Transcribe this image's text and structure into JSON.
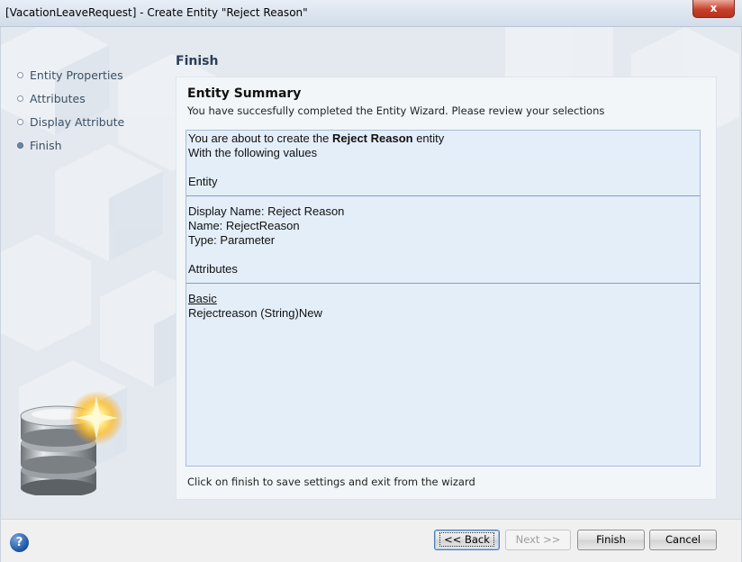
{
  "window": {
    "title": "[VacationLeaveRequest] - Create Entity \"Reject Reason\"",
    "close_label": "x"
  },
  "sidebar": {
    "steps": [
      {
        "label": "Entity Properties",
        "active": false
      },
      {
        "label": "Attributes",
        "active": false
      },
      {
        "label": "Display Attribute",
        "active": false
      },
      {
        "label": "Finish",
        "active": true
      }
    ]
  },
  "page": {
    "heading": "Finish"
  },
  "summary": {
    "title": "Entity Summary",
    "subtitle": "You have succesfully completed the Entity Wizard. Please review your selections",
    "intro_prefix": "You are about to create the ",
    "entity_name": "Reject Reason",
    "intro_suffix": " entity",
    "intro_line2": "With the following values",
    "entity_section": "Entity",
    "display_name": "Display Name: Reject Reason",
    "name": "Name: RejectReason",
    "type": "Type: Parameter",
    "attributes_section": "Attributes",
    "attribute_group": "Basic",
    "attribute_item": "Rejectreason (String)New",
    "footer": "Click on finish to save settings and exit from the wizard"
  },
  "buttons": {
    "help": "?",
    "back": "<< Back",
    "next": "Next >>",
    "finish": "Finish",
    "cancel": "Cancel"
  },
  "colors": {
    "window_bg": "#e4e9ef",
    "summary_bg": "#e4eef9",
    "close_red": "#c7402a",
    "active_bullet": "#6f86a3"
  }
}
